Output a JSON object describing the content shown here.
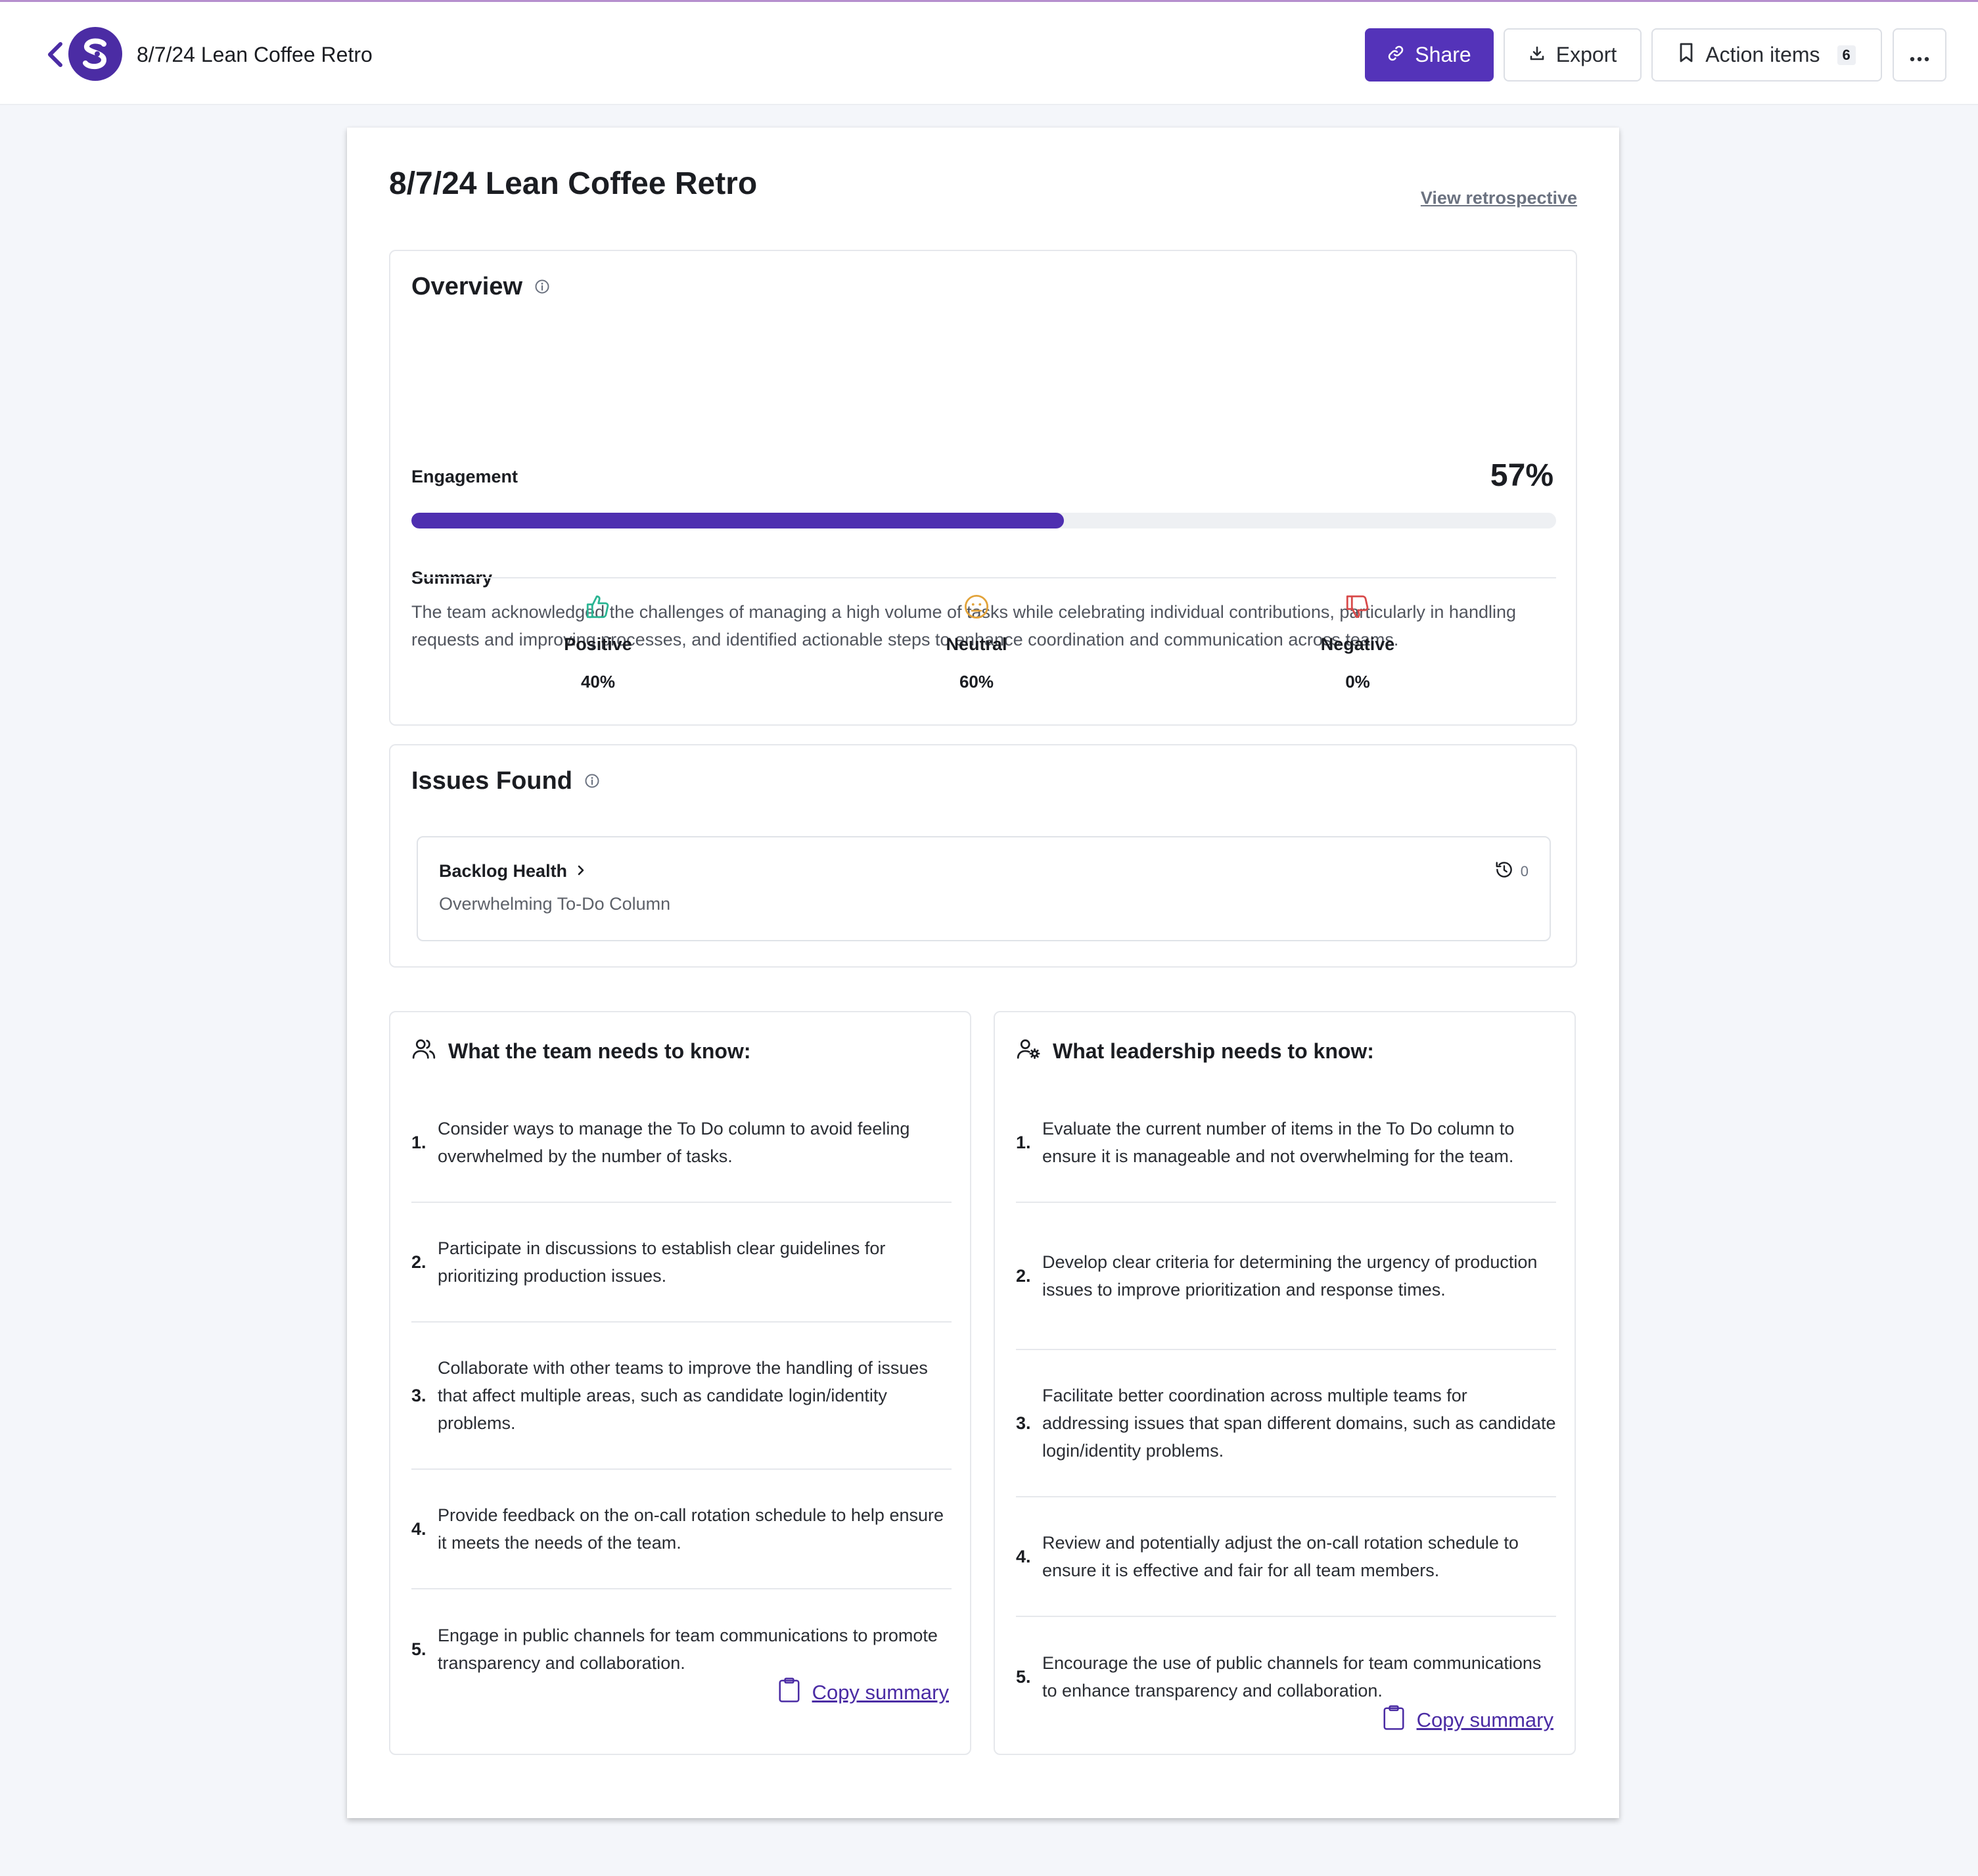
{
  "header": {
    "title": "8/7/24 Lean Coffee Retro",
    "share_label": "Share",
    "export_label": "Export",
    "action_items_label": "Action items",
    "action_items_count": "6"
  },
  "page": {
    "title": "8/7/24 Lean Coffee Retro",
    "view_link": "View retrospective"
  },
  "overview": {
    "title": "Overview",
    "engagement_label": "Engagement",
    "engagement_value": "57%",
    "engagement_fraction": 0.57,
    "summary_label": "Summary",
    "summary_text": "The team acknowledged the challenges of managing a high volume of tasks while celebrating individual contributions, particularly in handling requests and improving processes, and identified actionable steps to enhance coordination and communication across teams.",
    "sentiments": [
      {
        "label": "Positive",
        "value": "40%",
        "icon": "thumbs-up-icon",
        "color": "#2bb593"
      },
      {
        "label": "Neutral",
        "value": "60%",
        "icon": "neutral-face-icon",
        "color": "#e2a33a"
      },
      {
        "label": "Negative",
        "value": "0%",
        "icon": "thumbs-down-icon",
        "color": "#d84a4a"
      }
    ]
  },
  "issues": {
    "title": "Issues Found",
    "items": [
      {
        "title": "Backlog Health",
        "subtitle": "Overwhelming To-Do Column",
        "count": "0"
      }
    ]
  },
  "team": {
    "title": "What the team needs to know:",
    "items": [
      {
        "num": "1.",
        "text": "Consider ways to manage the To Do column to avoid feeling overwhelmed by the number of tasks."
      },
      {
        "num": "2.",
        "text": "Participate in discussions to establish clear guidelines for prioritizing production issues."
      },
      {
        "num": "3.",
        "text": "Collaborate with other teams to improve the handling of issues that affect multiple areas, such as candidate login/identity problems."
      },
      {
        "num": "4.",
        "text": "Provide feedback on the on-call rotation schedule to help ensure it meets the needs of the team."
      },
      {
        "num": "5.",
        "text": "Engage in public channels for team communications to promote transparency and collaboration."
      }
    ],
    "copy_label": "Copy summary"
  },
  "leadership": {
    "title": "What leadership needs to know:",
    "items": [
      {
        "num": "1.",
        "text": "Evaluate the current number of items in the To Do column to ensure it is manageable and not overwhelming for the team."
      },
      {
        "num": "2.",
        "text": "Develop clear criteria for determining the urgency of production issues to improve prioritization and response times."
      },
      {
        "num": "3.",
        "text": "Facilitate better coordination across multiple teams for addressing issues that span different domains, such as candidate login/identity problems."
      },
      {
        "num": "4.",
        "text": "Review and potentially adjust the on-call rotation schedule to ensure it is effective and fair for all team members."
      },
      {
        "num": "5.",
        "text": "Encourage the use of public channels for team communications to enhance transparency and collaboration."
      }
    ],
    "copy_label": "Copy summary"
  },
  "colors": {
    "brand": "#5433b9",
    "logo": "#4b2ca4",
    "progress": "#4e2fb0"
  }
}
